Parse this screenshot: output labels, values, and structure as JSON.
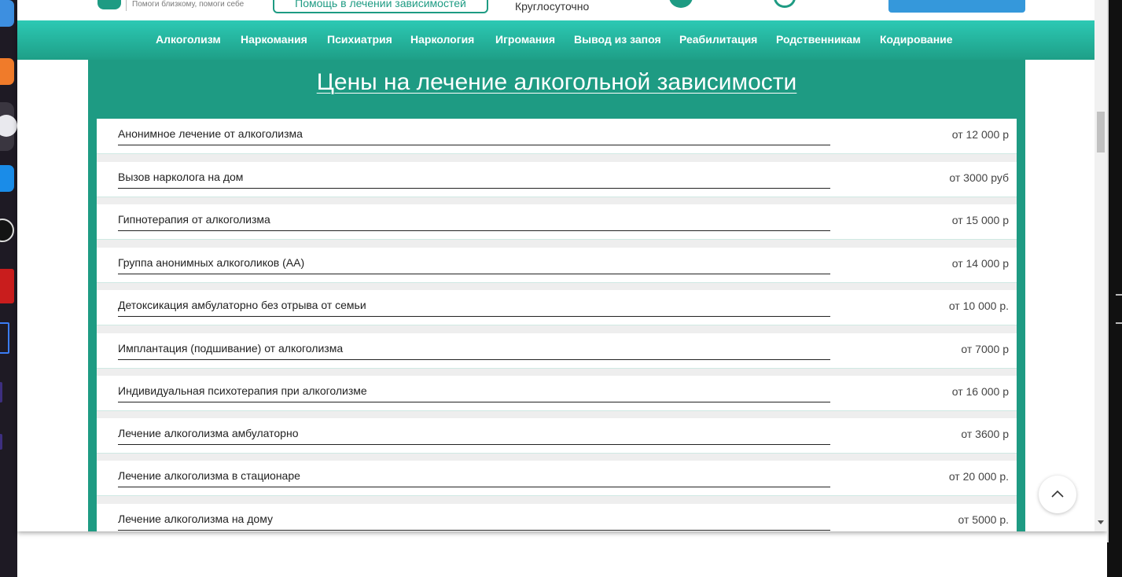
{
  "header": {
    "tagline": "Помоги близкому, помоги себе",
    "help_button": "Помощь в лечении зависимостей",
    "hours": "Круглосуточно",
    "icons": [
      "logo-icon",
      "telegram-icon",
      "whatsapp-icon"
    ]
  },
  "nav": {
    "items": [
      "Алкоголизм",
      "Наркомания",
      "Психиатрия",
      "Наркология",
      "Игромания",
      "Вывод из запоя",
      "Реабилитация",
      "Родственникам",
      "Кодирование"
    ]
  },
  "prices": {
    "title": "Цены на лечение алкогольной зависимости",
    "rows": [
      {
        "name": "Анонимное лечение от алкоголизма",
        "price": "от 12 000 р"
      },
      {
        "name": "Вызов нарколога на дом",
        "price": "от 3000 руб"
      },
      {
        "name": "Гипнотерапия от алкоголизма",
        "price": "от 15 000 р"
      },
      {
        "name": "Группа анонимных алкоголиков (АА)",
        "price": "от 14 000 р"
      },
      {
        "name": "Детоксикация амбулаторно без отрыва от семьи",
        "price": "от 10 000 р."
      },
      {
        "name": "Имплантация (подшивание) от алкоголизма",
        "price": "от 7000 р"
      },
      {
        "name": "Индивидуальная психотерапия при алкоголизме",
        "price": "от 16 000 р"
      },
      {
        "name": "Лечение алкоголизма амбулаторно",
        "price": "от 3600 р"
      },
      {
        "name": "Лечение алкоголизма в стационаре",
        "price": "от 20 000 р."
      },
      {
        "name": "Лечение алкоголизма на дому",
        "price": "от 5000 р."
      }
    ]
  },
  "colors": {
    "brand_green": "#1e9b83",
    "nav_gradient_top": "#2cc9b4",
    "cta_blue": "#3598db"
  },
  "scroll_top_icon": "chevron-up-icon"
}
